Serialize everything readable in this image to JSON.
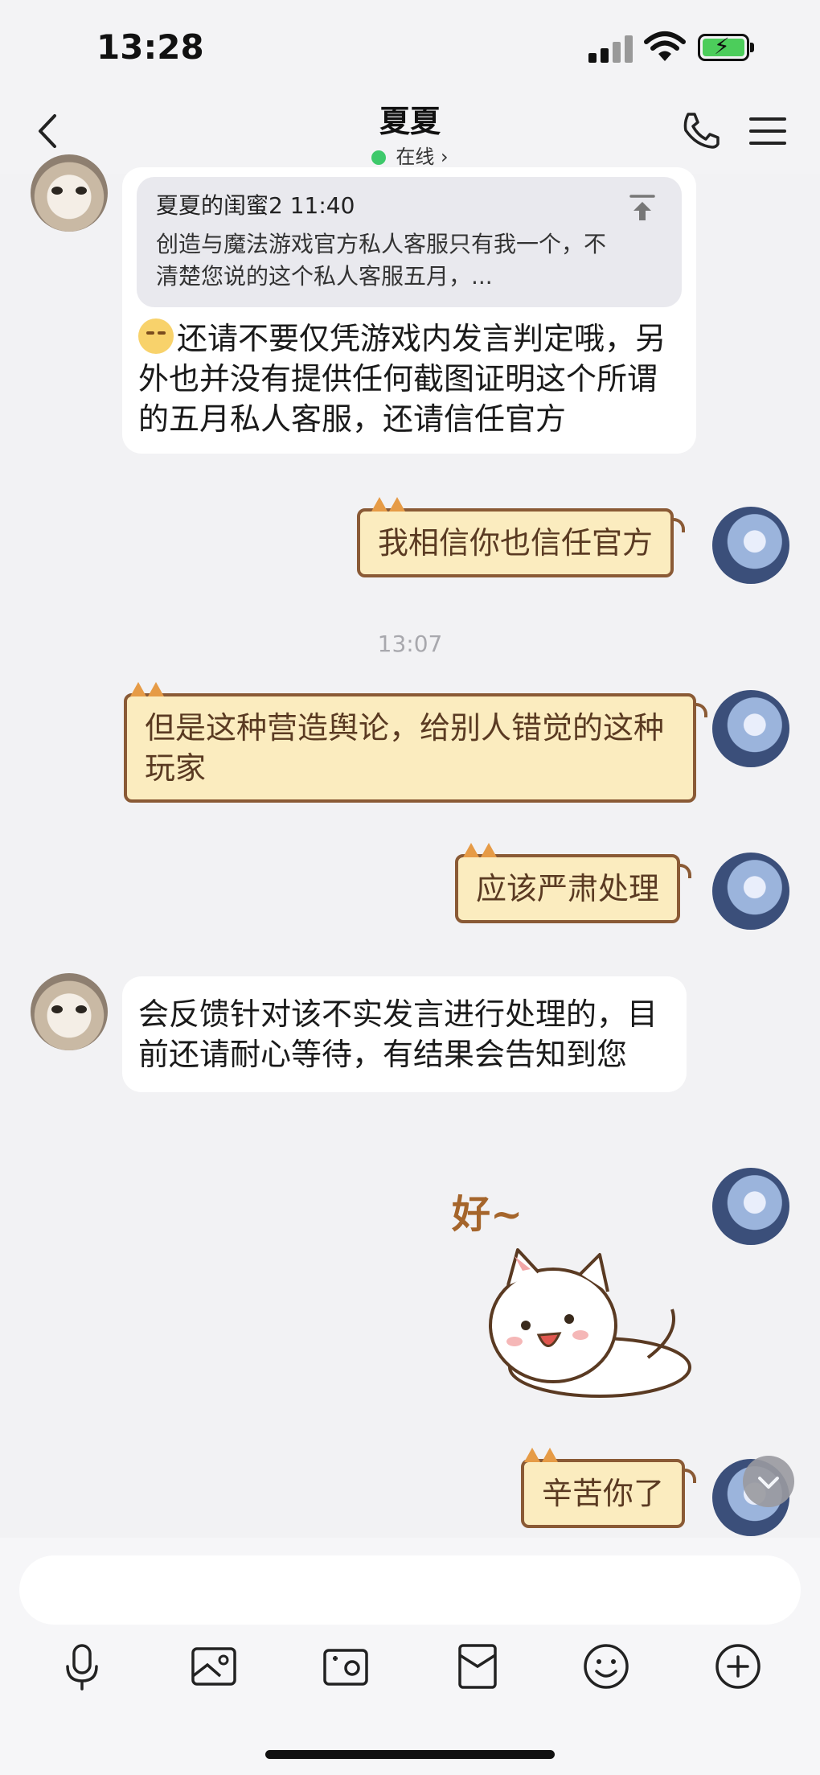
{
  "status_bar": {
    "time": "13:28"
  },
  "header": {
    "contact_name": "夏夏",
    "presence": "在线",
    "presence_chevron": "›"
  },
  "messages": {
    "quote": {
      "sender_time": "夏夏的闺蜜2 11:40",
      "text": "创造与魔法游戏官方私人客服只有我一个，不清楚您说的这个私人客服五月，..."
    },
    "reply_1": "还请不要仅凭游戏内发言判定哦，另外也并没有提供任何截图证明这个所谓的五月私人客服，还请信任官方",
    "out_1": "我相信你也信任官方",
    "timestamp": "13:07",
    "out_2": "但是这种营造舆论，给别人错觉的这种玩家",
    "out_3": "应该严肃处理",
    "reply_2": "会反馈针对该不实发言进行处理的，目前还请耐心等待，有结果会告知到您",
    "sticker_text": "好~",
    "out_4": "辛苦你了"
  },
  "icons": [
    "back-icon",
    "phone-icon",
    "menu-icon",
    "pin-icon",
    "microphone-icon",
    "image-icon",
    "camera-icon",
    "red-packet-icon",
    "emoji-icon",
    "plus-icon",
    "chevron-down-icon"
  ],
  "colors": {
    "bubble_fill": "#fbecbf",
    "bubble_border": "#8a5a35",
    "online": "#3ec96b",
    "background": "#f2f2f4"
  }
}
